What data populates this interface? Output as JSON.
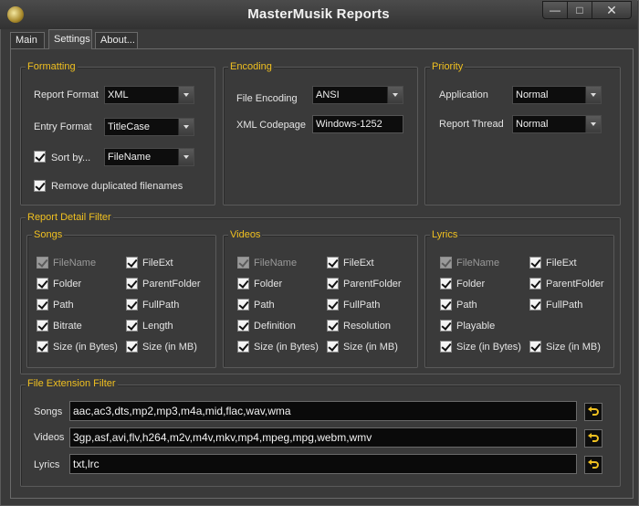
{
  "window": {
    "title": "MasterMusik Reports"
  },
  "caption_buttons": {
    "minimize": "—",
    "maximize": "□",
    "close": "✕"
  },
  "tabs": [
    {
      "label": "Main"
    },
    {
      "label": "Settings"
    },
    {
      "label": "About..."
    }
  ],
  "formatting": {
    "legend": "Formatting",
    "report_format_label": "Report Format",
    "report_format_value": "XML",
    "entry_format_label": "Entry Format",
    "entry_format_value": "TitleCase",
    "sort_by_label": "Sort by...",
    "sort_by_checked": true,
    "sort_by_value": "FileName",
    "remove_duplicates_label": "Remove duplicated filenames",
    "remove_duplicates_checked": true
  },
  "encoding": {
    "legend": "Encoding",
    "file_encoding_label": "File Encoding",
    "file_encoding_value": "ANSI",
    "xml_codepage_label": "XML Codepage",
    "xml_codepage_value": "Windows-1252"
  },
  "priority": {
    "legend": "Priority",
    "application_label": "Application",
    "application_value": "Normal",
    "report_thread_label": "Report Thread",
    "report_thread_value": "Normal"
  },
  "report_detail_filter": {
    "legend": "Report Detail Filter",
    "songs": {
      "legend": "Songs",
      "left": [
        {
          "label": "FileName",
          "disabled": true
        },
        {
          "label": "Folder"
        },
        {
          "label": "Path"
        },
        {
          "label": "Bitrate"
        },
        {
          "label": "Size (in Bytes)"
        }
      ],
      "right": [
        {
          "label": "FileExt"
        },
        {
          "label": "ParentFolder"
        },
        {
          "label": "FullPath"
        },
        {
          "label": "Length"
        },
        {
          "label": "Size (in MB)"
        }
      ]
    },
    "videos": {
      "legend": "Videos",
      "left": [
        {
          "label": "FileName",
          "disabled": true
        },
        {
          "label": "Folder"
        },
        {
          "label": "Path"
        },
        {
          "label": "Definition"
        },
        {
          "label": "Size (in Bytes)"
        }
      ],
      "right": [
        {
          "label": "FileExt"
        },
        {
          "label": "ParentFolder"
        },
        {
          "label": "FullPath"
        },
        {
          "label": "Resolution"
        },
        {
          "label": "Size (in MB)"
        }
      ]
    },
    "lyrics": {
      "legend": "Lyrics",
      "left": [
        {
          "label": "FileName",
          "disabled": true
        },
        {
          "label": "Folder"
        },
        {
          "label": "Path"
        },
        {
          "label": "Playable"
        },
        {
          "label": "Size (in Bytes)"
        }
      ],
      "right": [
        {
          "label": "FileExt"
        },
        {
          "label": "ParentFolder"
        },
        {
          "label": "FullPath"
        },
        {
          "label": "Size (in MB)"
        }
      ]
    }
  },
  "file_extension_filter": {
    "legend": "File Extension Filter",
    "songs_label": "Songs",
    "songs_value": "aac,ac3,dts,mp2,mp3,m4a,mid,flac,wav,wma",
    "videos_label": "Videos",
    "videos_value": "3gp,asf,avi,flv,h264,m2v,m4v,mkv,mp4,mpeg,mpg,webm,wmv",
    "lyrics_label": "Lyrics",
    "lyrics_value": "txt,lrc"
  },
  "icons": {
    "app": "app-icon",
    "reset": "undo-arrow-icon",
    "dropdown": "chevron-down-icon",
    "check": "checkmark-icon"
  },
  "colors": {
    "accent": "#f0c020",
    "background": "#3a3a3a",
    "field": "#0d0d0d"
  }
}
